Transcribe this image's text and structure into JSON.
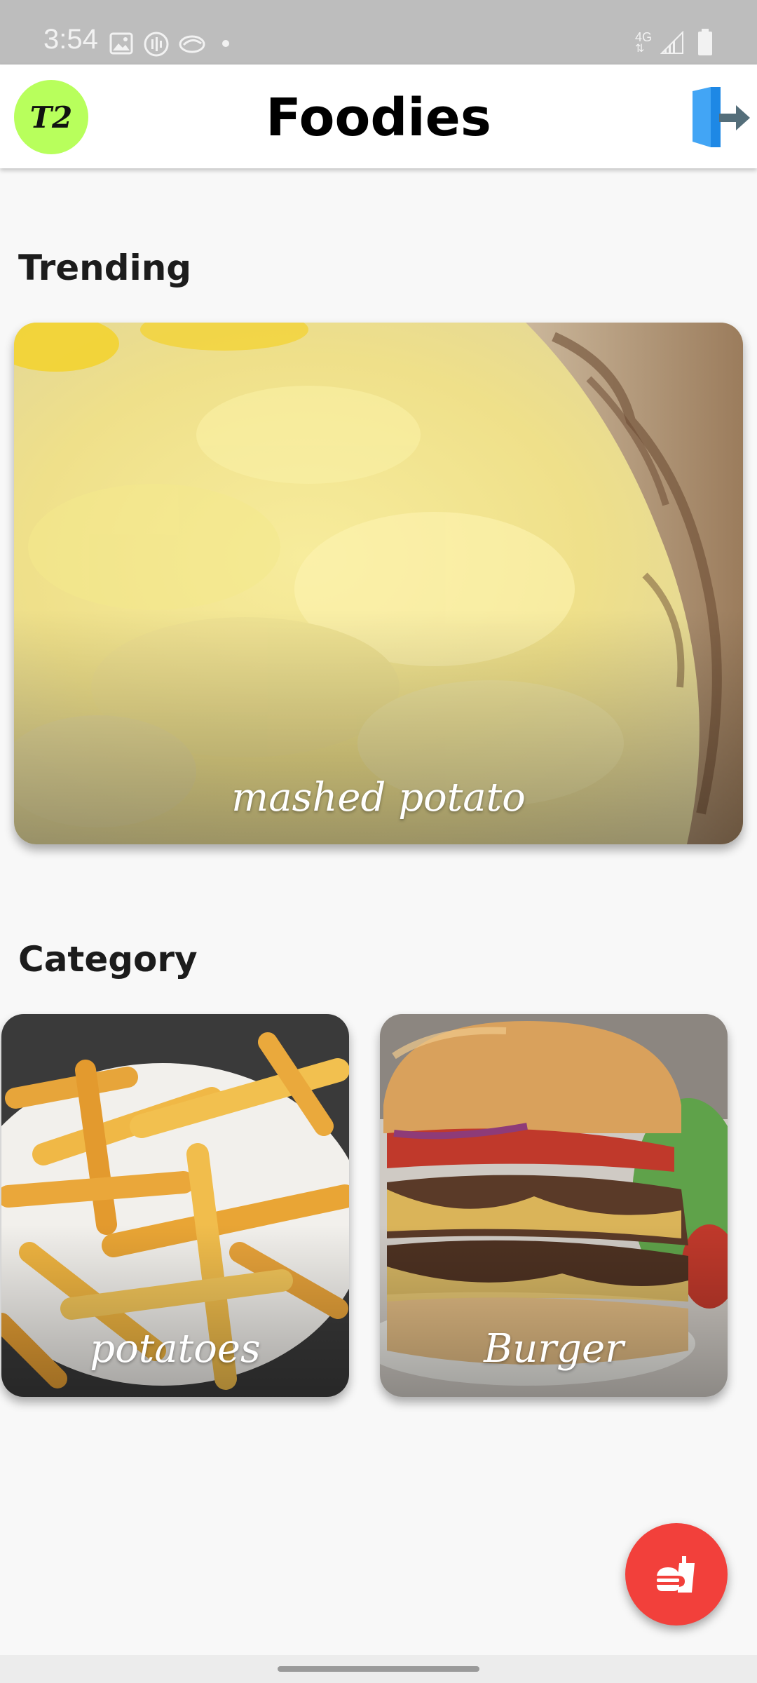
{
  "status_bar": {
    "time": "3:54",
    "left_icons": [
      "image-icon",
      "podcast-icon",
      "cloud-icon",
      "dot-icon"
    ],
    "right_icons": [
      "4g-icon",
      "signal-icon",
      "battery-icon"
    ],
    "network": "4G"
  },
  "app_bar": {
    "avatar_text": "T2",
    "title": "Foodies",
    "logout_icon": "logout-icon",
    "avatar_color": "#b8ff5c"
  },
  "trending": {
    "title": "Trending",
    "item": {
      "label": "mashed potato",
      "image": "mashed-potato-photo"
    }
  },
  "category": {
    "title": "Category",
    "items": [
      {
        "label": "potatoes",
        "image": "french-fries-photo"
      },
      {
        "label": "Burger",
        "image": "burger-photo"
      }
    ]
  },
  "fab": {
    "icon": "fast-food-icon",
    "color": "#f2403b"
  },
  "colors": {
    "background": "#f8f8f8",
    "status_bar": "#bdbdbd",
    "accent": "#f2403b"
  }
}
